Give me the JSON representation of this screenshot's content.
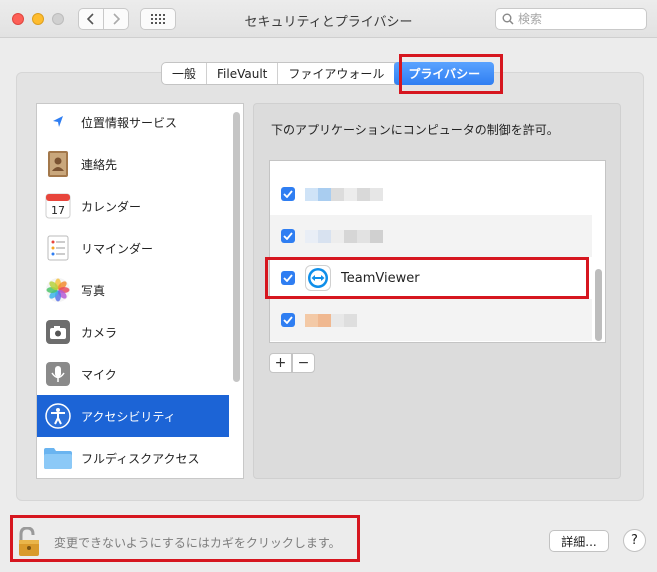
{
  "window": {
    "title": "セキュリティとプライバシー"
  },
  "search": {
    "placeholder": "検索"
  },
  "tabs": [
    {
      "label": "一般"
    },
    {
      "label": "FileVault"
    },
    {
      "label": "ファイアウォール"
    },
    {
      "label": "プライバシー",
      "active": true
    }
  ],
  "sidebar": {
    "items": [
      {
        "label": "位置情報サービス",
        "icon": "location-arrow-icon"
      },
      {
        "label": "連絡先",
        "icon": "contacts-book-icon"
      },
      {
        "label": "カレンダー",
        "icon": "calendar-icon",
        "icon_text": "17"
      },
      {
        "label": "リマインダー",
        "icon": "reminders-icon"
      },
      {
        "label": "写真",
        "icon": "photos-icon"
      },
      {
        "label": "カメラ",
        "icon": "camera-icon"
      },
      {
        "label": "マイク",
        "icon": "microphone-icon"
      },
      {
        "label": "アクセシビリティ",
        "icon": "accessibility-icon",
        "selected": true
      },
      {
        "label": "フルディスクアクセス",
        "icon": "folder-icon"
      }
    ]
  },
  "main": {
    "header": "下のアプリケーションにコンピュータの制御を許可。",
    "apps": [
      {
        "name": "",
        "checked": true,
        "blurred": true
      },
      {
        "name": "",
        "checked": true,
        "blurred": true
      },
      {
        "name": "TeamViewer",
        "checked": true,
        "blurred": false
      },
      {
        "name": "",
        "checked": true,
        "blurred": true
      }
    ],
    "add_label": "+",
    "remove_label": "−"
  },
  "footer": {
    "lock_text": "変更できないようにするにはカギをクリックします。",
    "advanced_label": "詳細...",
    "help_label": "?"
  },
  "colors": {
    "accent": "#2f7ef2",
    "selection": "#1c64d6",
    "highlight": "#d6161f"
  }
}
